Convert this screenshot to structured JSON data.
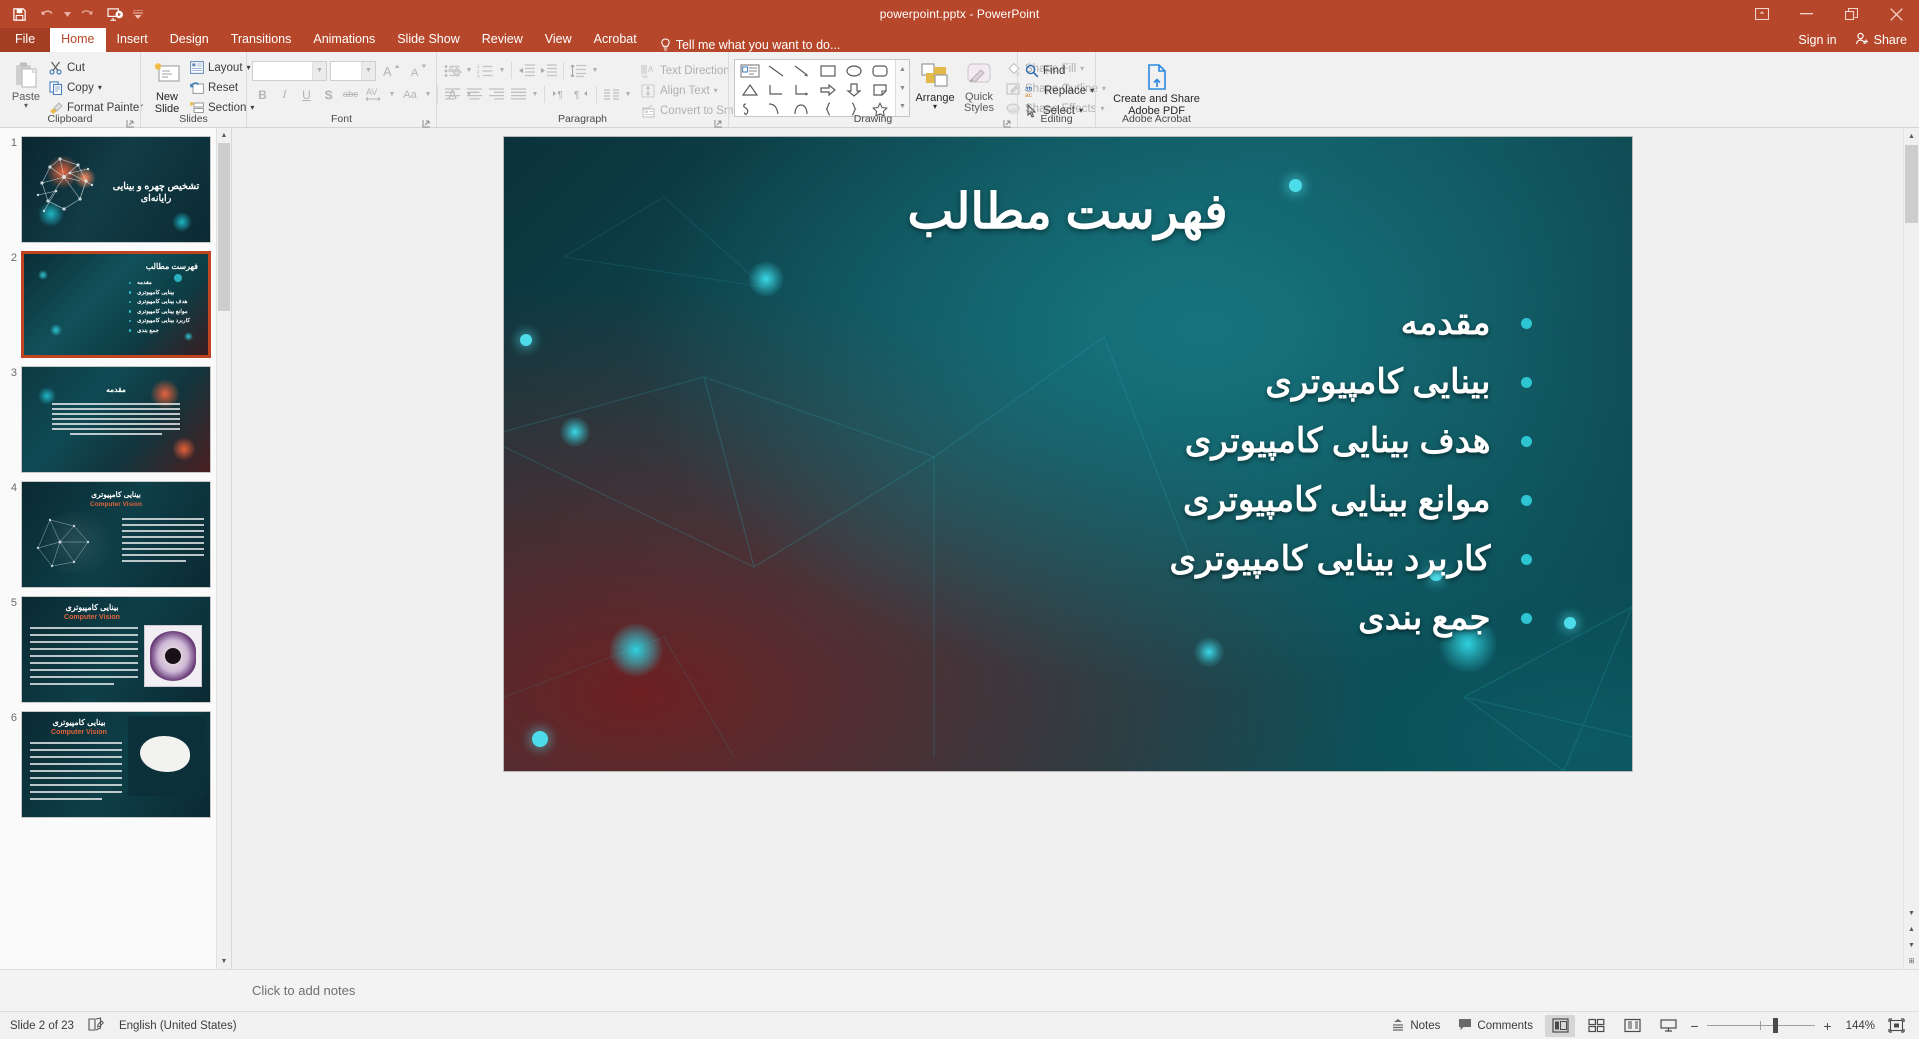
{
  "titlebar": {
    "document_title": "powerpoint.pptx - PowerPoint",
    "qat": [
      {
        "name": "save-icon",
        "label": "Save"
      },
      {
        "name": "undo-icon",
        "label": "Undo"
      },
      {
        "name": "redo-icon",
        "label": "Repeat"
      },
      {
        "name": "start-presentation-icon",
        "label": "Start From Beginning"
      },
      {
        "name": "customize-qat-icon",
        "label": "Customize Quick Access Toolbar"
      }
    ],
    "window_controls": [
      {
        "name": "ribbon-display-options-icon",
        "label": "Ribbon Display Options"
      },
      {
        "name": "minimize-icon",
        "label": "Minimize"
      },
      {
        "name": "restore-icon",
        "label": "Restore Down"
      },
      {
        "name": "close-icon",
        "label": "Close"
      }
    ]
  },
  "tabs": [
    {
      "label": "File",
      "active": false,
      "file": true
    },
    {
      "label": "Home",
      "active": true,
      "file": false
    },
    {
      "label": "Insert",
      "active": false,
      "file": false
    },
    {
      "label": "Design",
      "active": false,
      "file": false
    },
    {
      "label": "Transitions",
      "active": false,
      "file": false
    },
    {
      "label": "Animations",
      "active": false,
      "file": false
    },
    {
      "label": "Slide Show",
      "active": false,
      "file": false
    },
    {
      "label": "Review",
      "active": false,
      "file": false
    },
    {
      "label": "View",
      "active": false,
      "file": false
    },
    {
      "label": "Acrobat",
      "active": false,
      "file": false
    }
  ],
  "tell_me": "Tell me what you want to do...",
  "account": {
    "sign_in": "Sign in",
    "share": "Share"
  },
  "ribbon": {
    "groups": [
      {
        "label": "Clipboard",
        "paste": "Paste",
        "items": [
          {
            "label": "Cut",
            "icon": "scissors-icon"
          },
          {
            "label": "Copy",
            "icon": "copy-icon"
          },
          {
            "label": "Format Painter",
            "icon": "paintbrush-icon"
          }
        ]
      },
      {
        "label": "Slides",
        "new_slide": "New Slide",
        "items": [
          {
            "label": "Layout",
            "icon": "layout-icon"
          },
          {
            "label": "Reset",
            "icon": "reset-icon"
          },
          {
            "label": "Section",
            "icon": "section-icon"
          }
        ]
      },
      {
        "label": "Font",
        "font_name": "",
        "font_size": "",
        "buttons": [
          {
            "name": "bold-button",
            "glyph": "B"
          },
          {
            "name": "italic-button",
            "glyph": "I"
          },
          {
            "name": "underline-button",
            "glyph": "U"
          },
          {
            "name": "shadow-button",
            "glyph": "S"
          },
          {
            "name": "strikethrough-button",
            "glyph": "abc"
          },
          {
            "name": "character-spacing-button",
            "glyph": "AV"
          },
          {
            "name": "change-case-button",
            "glyph": "Aa"
          },
          {
            "name": "font-color-button",
            "glyph": "A"
          }
        ]
      },
      {
        "label": "Paragraph",
        "items": [
          {
            "label": "Text Direction",
            "icon": "text-direction-icon"
          },
          {
            "label": "Align Text",
            "icon": "align-text-icon"
          },
          {
            "label": "Convert to SmartArt",
            "icon": "smartart-icon"
          }
        ]
      },
      {
        "label": "Drawing",
        "arrange": "Arrange",
        "quick_styles": "Quick Styles",
        "items": [
          {
            "label": "Shape Fill",
            "icon": "shape-fill-icon"
          },
          {
            "label": "Shape Outline",
            "icon": "shape-outline-icon"
          },
          {
            "label": "Shape Effects",
            "icon": "shape-effects-icon"
          }
        ]
      },
      {
        "label": "Editing",
        "items": [
          {
            "label": "Find",
            "icon": "search-icon"
          },
          {
            "label": "Replace",
            "icon": "replace-icon"
          },
          {
            "label": "Select",
            "icon": "select-icon"
          }
        ]
      },
      {
        "label": "Adobe Acrobat",
        "create_share_pdf": "Create and Share Adobe PDF"
      }
    ]
  },
  "slide": {
    "title": "فهرست مطالب",
    "bullets": [
      "مقدمه",
      "بینایی کامپیوتری",
      "هدف بینایی کامپیوتری",
      "موانع بینایی کامپیوتری",
      "کاربرد بینایی کامپیوتری",
      "جمع بندی"
    ],
    "accent_color": "#2ec5d3",
    "background_color": "#0d3c44"
  },
  "thumbnails": [
    {
      "number": "1",
      "title": "تشخیص چهره و بینایی رایانه‌ای",
      "selected": false,
      "kind": "title"
    },
    {
      "number": "2",
      "title": "فهرست مطالب",
      "selected": true,
      "kind": "toc",
      "lines": [
        "مقدمه",
        "بینایی کامپیوتری",
        "هدف بینایی کامپیوتری",
        "موانع بینایی کامپیوتری",
        "کاربرد بینایی کامپیوتری",
        "جمع بندی"
      ]
    },
    {
      "number": "3",
      "title": "مقدمه",
      "selected": false,
      "kind": "text"
    },
    {
      "number": "4",
      "title": "بینایی کامپیوتری",
      "subtitle": "Computer Vision",
      "selected": false,
      "kind": "split"
    },
    {
      "number": "5",
      "title": "بینایی کامپیوتری",
      "subtitle": "Computer Vision",
      "selected": false,
      "kind": "image"
    },
    {
      "number": "6",
      "title": "بینایی کامپیوتری",
      "subtitle": "Computer Vision",
      "selected": false,
      "kind": "image2"
    }
  ],
  "notes": {
    "placeholder": "Click to add notes"
  },
  "statusbar": {
    "slide_counter": "Slide 2 of 23",
    "language": "English (United States)",
    "notes_label": "Notes",
    "comments_label": "Comments",
    "zoom_level": "144%",
    "zoom_minus": "−",
    "zoom_plus": "+",
    "views": [
      {
        "name": "normal-view-button",
        "selected": true
      },
      {
        "name": "slide-sorter-view-button",
        "selected": false
      },
      {
        "name": "reading-view-button",
        "selected": false
      },
      {
        "name": "slideshow-view-button",
        "selected": false
      }
    ],
    "fit_slide_label": "Fit slide to current window"
  }
}
